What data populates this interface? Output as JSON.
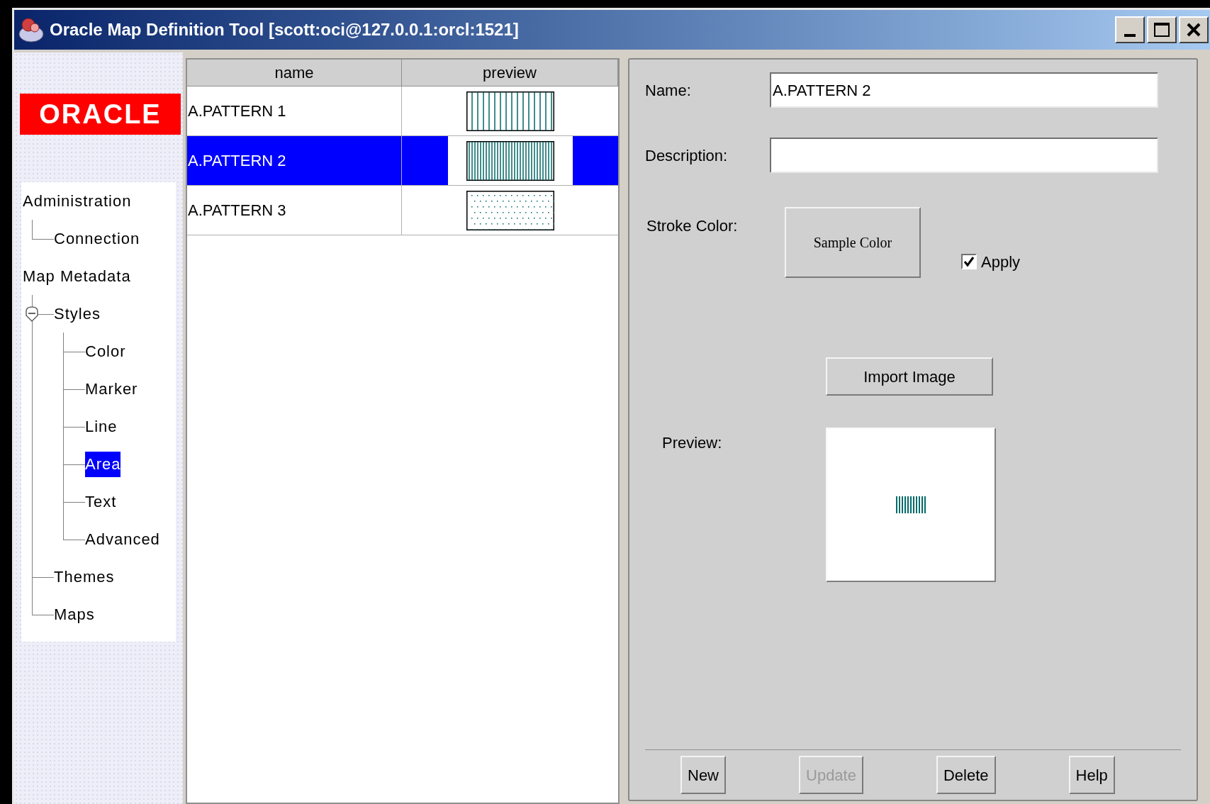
{
  "window": {
    "title": "Oracle Map Definition Tool [scott:oci@127.0.0.1:orcl:1521]"
  },
  "logo": {
    "text": "ORACLE"
  },
  "tree": [
    {
      "label": "Administration",
      "selected": false,
      "children": [
        {
          "label": "Connection",
          "selected": false
        }
      ]
    },
    {
      "label": "Map Metadata",
      "selected": false,
      "children": [
        {
          "label": "Styles",
          "selected": false,
          "expanded": true,
          "children": [
            {
              "label": "Color",
              "selected": false
            },
            {
              "label": "Marker",
              "selected": false
            },
            {
              "label": "Line",
              "selected": false
            },
            {
              "label": "Area",
              "selected": true
            },
            {
              "label": "Text",
              "selected": false
            },
            {
              "label": "Advanced",
              "selected": false
            }
          ]
        },
        {
          "label": "Themes",
          "selected": false
        },
        {
          "label": "Maps",
          "selected": false
        }
      ]
    }
  ],
  "table": {
    "columns": [
      "name",
      "preview"
    ],
    "rows": [
      {
        "name": "A.PATTERN 1",
        "kind": "stripes",
        "selected": false
      },
      {
        "name": "A.PATTERN 2",
        "kind": "dense",
        "selected": true
      },
      {
        "name": "A.PATTERN 3",
        "kind": "dots",
        "selected": false
      }
    ]
  },
  "form": {
    "name_label": "Name:",
    "name_value": "A.PATTERN 2",
    "description_label": "Description:",
    "stroke_color_label": "Stroke Color:",
    "sample_color_button": "Sample Color",
    "apply": {
      "label": "Apply",
      "checked": true
    },
    "import_button": "Import Image",
    "preview_label": "Preview:"
  },
  "buttons": [
    {
      "label": "New",
      "disabled": false
    },
    {
      "label": "Update",
      "disabled": true
    },
    {
      "label": "Delete",
      "disabled": false
    },
    {
      "label": "Help",
      "disabled": false
    }
  ]
}
